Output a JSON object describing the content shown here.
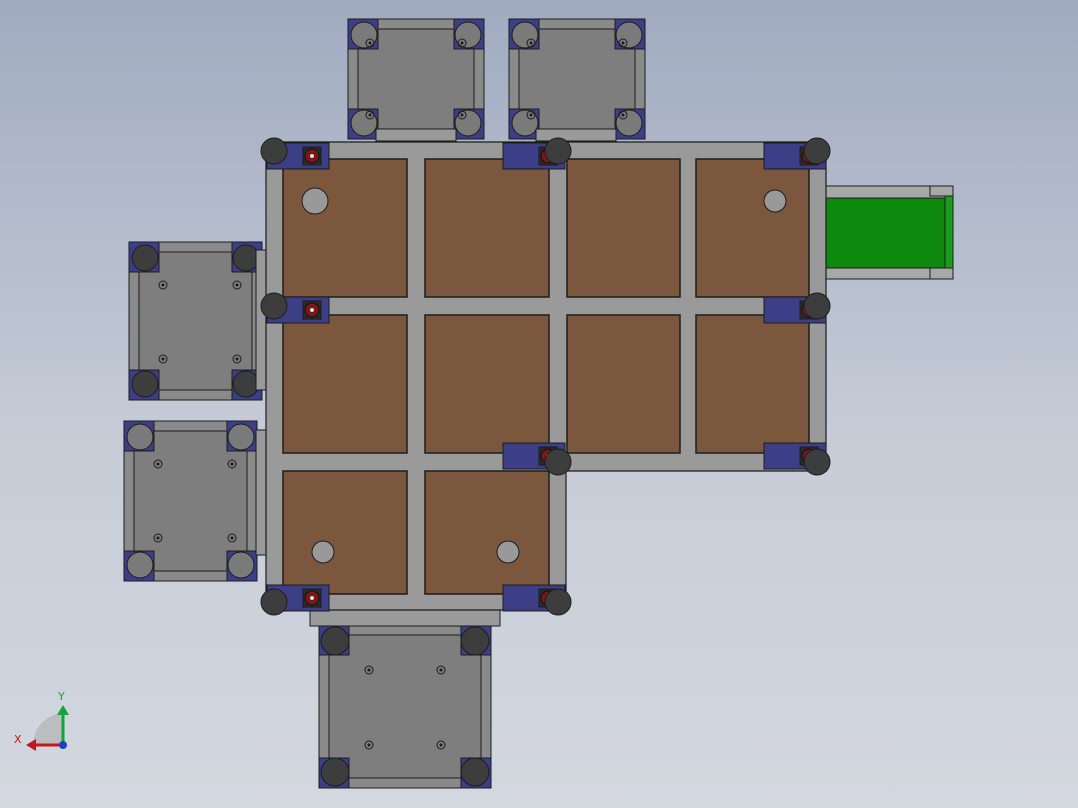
{
  "viewport": {
    "view_name": "top-view",
    "background_top": "#a0abc0",
    "background_bottom": "#d3d8df"
  },
  "colors": {
    "frame": "#9a9a9a",
    "frame_dark": "#6e6e6e",
    "outline": "#1c1c1c",
    "deck": "#7b583d",
    "hole": "#999999",
    "caster_plate": "#3c3e86",
    "caster_wheel": "#7a1717",
    "post": "#3d3d3d",
    "module_fill": "#8a8a8a",
    "conveyor_belt": "#0d8a0d",
    "conveyor_frame": "#a8a8a8",
    "axis_x": "#c4161c",
    "axis_y": "#14a336",
    "axis_origin": "#1f3fbf"
  },
  "assembly": {
    "deck_grid": {
      "rows": 3,
      "cols": 4,
      "panels_present": 10
    },
    "caster_count": 8,
    "post_count": 8,
    "peripheral_modules": [
      "top-left-module",
      "top-right-module",
      "left-upper-module",
      "left-lower-module",
      "bottom-module"
    ],
    "conveyor": "right-conveyor"
  },
  "triad": {
    "x_label": "X",
    "y_label": "Y",
    "icon": "coordinate-triad-icon"
  }
}
